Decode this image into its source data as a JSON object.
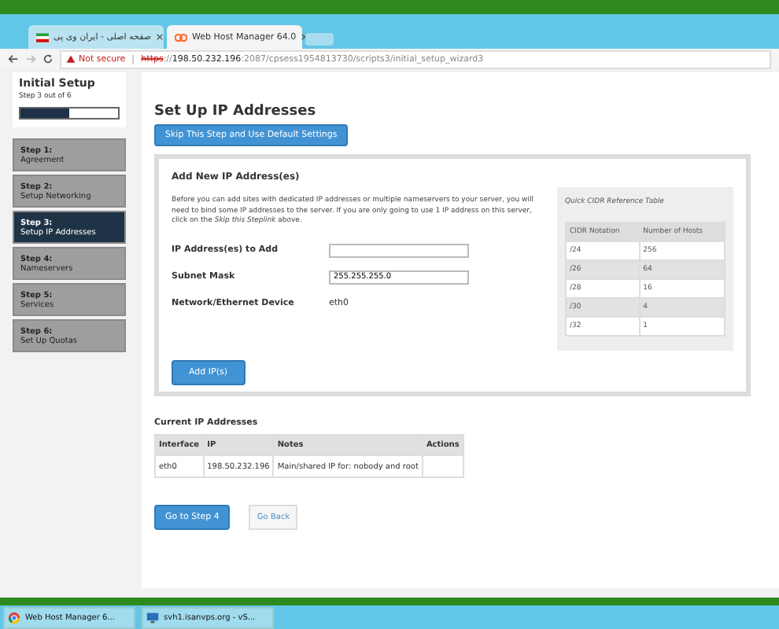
{
  "browser": {
    "tabs": [
      {
        "title": "صفحه اصلی - ایران وی پی",
        "selected": false,
        "kind": "flag"
      },
      {
        "title": "Web Host Manager 64.0",
        "selected": true,
        "kind": "cpanel"
      }
    ],
    "address": {
      "security": "Not secure",
      "scheme": "https",
      "separator": "://",
      "host": "198.50.232.196",
      "rest": ":2087/cpsess1954813730/scripts3/initial_setup_wizard3"
    }
  },
  "sidebar": {
    "title": "Initial Setup",
    "progress_text": "Step 3 out of 6",
    "level": 0.5,
    "steps": [
      {
        "step": "Step 1:",
        "name": "Agreement",
        "selected": false
      },
      {
        "step": "Step 2:",
        "name": "Setup Networking",
        "selected": false
      },
      {
        "step": "Step 3:",
        "name": "Setup IP Addresses",
        "selected": true
      },
      {
        "step": "Step 4:",
        "name": "Nameservers",
        "selected": false
      },
      {
        "step": "Step 5:",
        "name": "Services",
        "selected": false
      },
      {
        "step": "Step 6:",
        "name": "Set Up Quotas",
        "selected": false
      }
    ]
  },
  "main": {
    "title": "Set Up IP Addresses",
    "skip_button": "Skip This Step and Use Default Settings",
    "panel": {
      "title": "Add New IP Address(es)",
      "intro": "Before you can add sites with dedicated IP addresses or multiple nameservers to your server, you will need to bind some IP addresses to the server. If you are only going to use 1 IP address on this server, click on the *Skip this Steplink* above.",
      "fields": [
        {
          "kind": "input",
          "label": "IP Address(es) to Add"
        },
        {
          "kind": "input",
          "label": "Subnet Mask",
          "value": "255.255.255.0"
        },
        {
          "kind": "text",
          "label": "Network/Ethernet Device",
          "value": "eth0"
        }
      ],
      "cidr": {
        "caption": "Quick CIDR Reference Table",
        "columns": [
          "CIDR Notation",
          "Number of Hosts"
        ],
        "rows": [
          [
            "/24",
            "256"
          ],
          [
            "/26",
            "64"
          ],
          [
            "/28",
            "16"
          ],
          [
            "/30",
            "4"
          ],
          [
            "/32",
            "1"
          ]
        ]
      },
      "add_button": "Add IP(s)"
    },
    "current": {
      "title": "Current IP Addresses",
      "columns": [
        "Interface",
        "IP",
        "Notes",
        "Actions"
      ],
      "rows": [
        [
          "eth0",
          "198.50.232.196",
          "Main/shared IP for: nobody and root",
          ""
        ]
      ]
    },
    "next_button": "Go to Step 4",
    "back_button": "Go Back"
  },
  "taskbar": {
    "items": [
      {
        "title": "Web Host Manager 6...",
        "kind": "chrome"
      },
      {
        "title": "svh1.isanvps.org - vS...",
        "kind": "remote"
      }
    ]
  }
}
